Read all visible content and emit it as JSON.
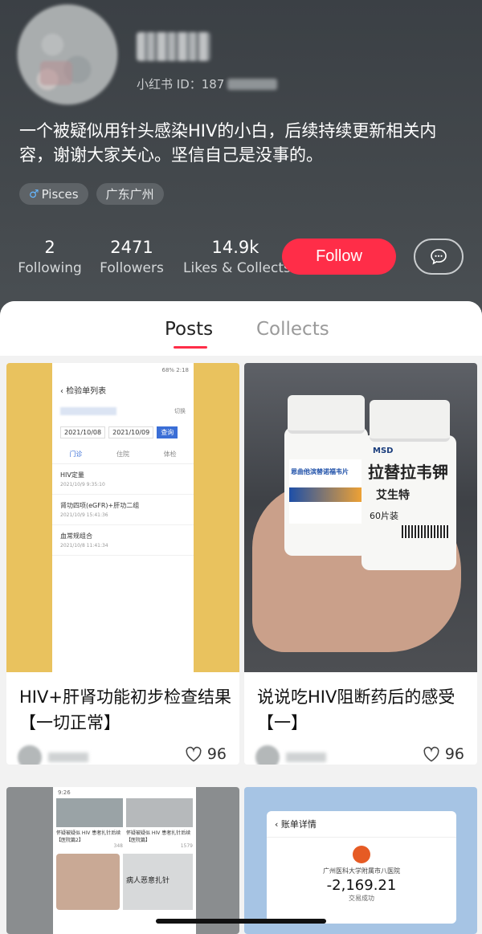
{
  "profile": {
    "rb_id_label": "小红书 ID：187",
    "bio": "一个被疑似用针头感染HIV的小白，后续持续更新相关内容，谢谢大家关心。坚信自己是没事的。",
    "tags": [
      {
        "icon": "male-icon",
        "label": "Pisces"
      },
      {
        "label": "广东广州"
      }
    ],
    "stats": [
      {
        "value": "2",
        "label": "Following"
      },
      {
        "value": "2471",
        "label": "Followers"
      },
      {
        "value": "14.9k",
        "label": "Likes & Collects"
      }
    ],
    "follow_label": "Follow",
    "accent_color": "#ff2d48"
  },
  "tabs": [
    {
      "label": "Posts",
      "active": true
    },
    {
      "label": "Collects",
      "active": false
    }
  ],
  "posts": [
    {
      "title": "HIV+肝肾功能初步检查结果【一切正常】",
      "likes": "96",
      "screenshot": {
        "status_left": "",
        "status_right": "68% 2:18",
        "title": "检验单列表",
        "switch_label": "切换",
        "date_from": "2021/10/08",
        "date_to": "2021/10/09",
        "query_label": "查询",
        "tabs": [
          "门诊",
          "住院",
          "体检"
        ],
        "items": [
          {
            "name": "HIV定量",
            "time": "2021/10/9 9:35:10"
          },
          {
            "name": "肾功四项(eGFR)+肝功二组",
            "time": "2021/10/9 15:41:36"
          },
          {
            "name": "血常规组合",
            "time": "2021/10/8 11:41:34"
          }
        ]
      }
    },
    {
      "title": "说说吃HIV阻断药后的感受【一】",
      "likes": "96",
      "bottles": {
        "left_label": "恩曲他滨替诺福韦片",
        "right_label": "拉替拉韦钾",
        "right_brand": "MSD",
        "right_sub": "艾生特",
        "right_count": "60片装"
      }
    },
    {
      "title": "",
      "mini": {
        "status": "9:26",
        "item1": "怀疑被疑似 HIV 患者扎针后续【医院篇2】",
        "item2": "怀疑被疑似 HIV 患者扎针后续【医院篇】",
        "likes1": "348",
        "likes2": "1579",
        "caption": "病人恶意扎针"
      }
    },
    {
      "title": "",
      "bill": {
        "header": "账单详情",
        "hospital": "广州医科大学附属市八医院",
        "amount": "-2,169.21",
        "status": "交易成功"
      }
    }
  ]
}
